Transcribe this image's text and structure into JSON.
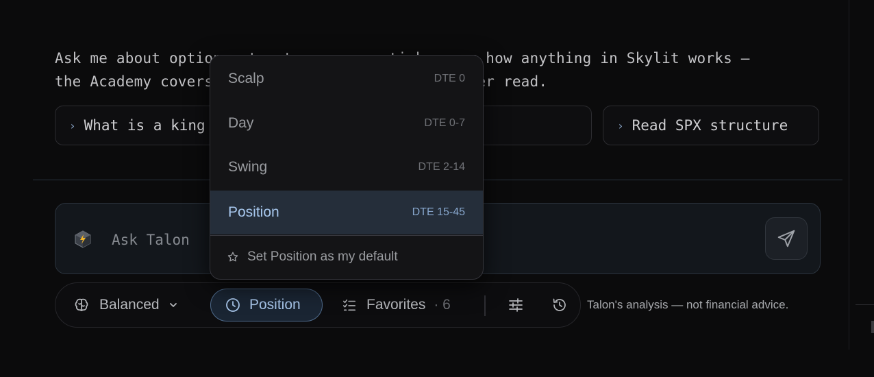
{
  "intro": "Ask me about options structure on any ticker, or how anything in Skylit works —\nthe Academy covers the details if you would rather read.",
  "suggestions": [
    {
      "label": "What is a king node and how do payouts work?"
    },
    {
      "label": "Read SPX structure"
    }
  ],
  "composer": {
    "placeholder": "Ask Talon",
    "icons": {
      "avatar": "talon-cube-icon",
      "send": "send-icon"
    }
  },
  "toolbar": {
    "mode": "Balanced",
    "horizon": "Position",
    "favorites_label": "Favorites",
    "favorites_count": "· 6",
    "icons": [
      "brain-icon",
      "chevron-down-icon",
      "clock-icon",
      "checklist-icon",
      "sliders-icon",
      "history-icon"
    ]
  },
  "disclaimer": "Talon's analysis — not financial advice.",
  "horizon_menu": {
    "options": [
      {
        "label": "Scalp",
        "dte": "DTE 0"
      },
      {
        "label": "Day",
        "dte": "DTE 0-7"
      },
      {
        "label": "Swing",
        "dte": "DTE 2-14"
      },
      {
        "label": "Position",
        "dte": "DTE 15-45",
        "selected": true
      }
    ],
    "set_default": "Set Position as my default"
  },
  "colors": {
    "background": "#0b0b0c",
    "accent": "#a8c8ee",
    "selected_bg": "#252e3a",
    "panel": "#141416"
  }
}
